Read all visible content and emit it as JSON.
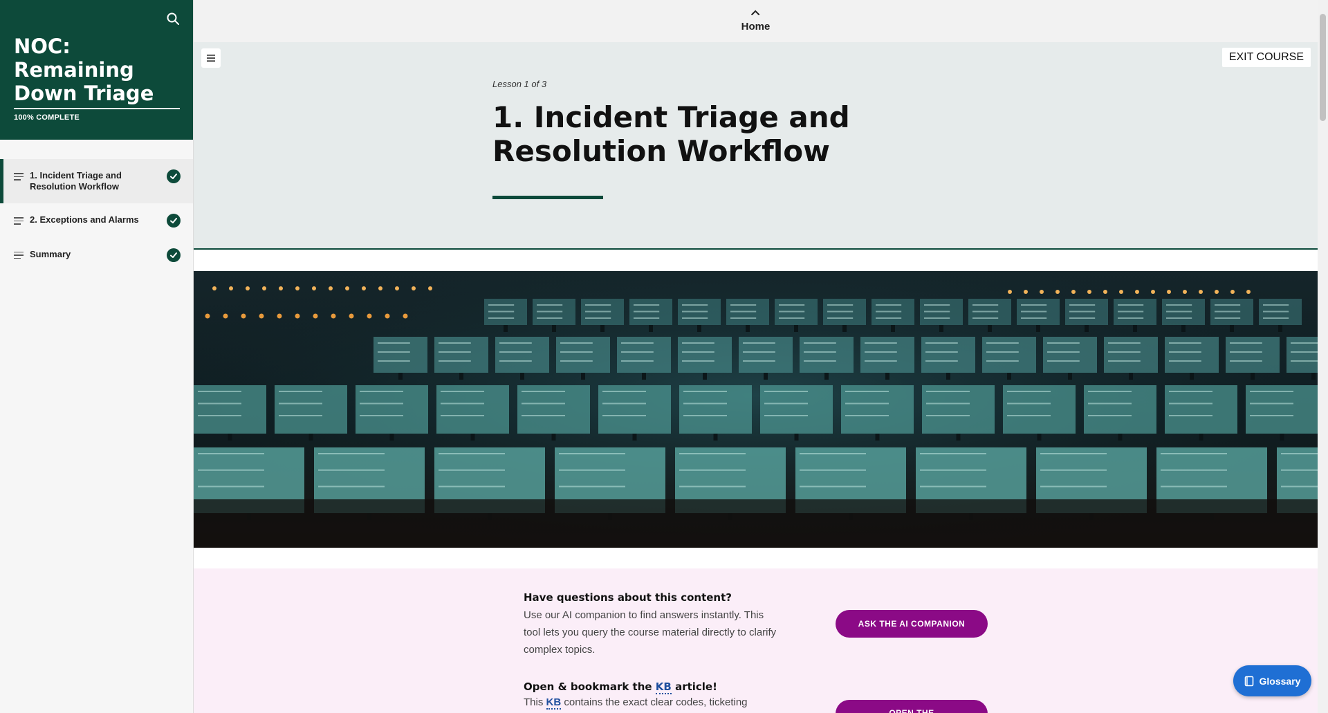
{
  "sidebar": {
    "course_title": "NOC: Remaining Down Triage",
    "progress_label": "100% COMPLETE",
    "progress_percent": 100,
    "lessons": [
      {
        "label": "1. Incident Triage and Resolution Workflow",
        "complete": true,
        "active": true
      },
      {
        "label": "2. Exceptions and Alarms",
        "complete": true,
        "active": false
      },
      {
        "label": "Summary",
        "complete": true,
        "active": false
      }
    ]
  },
  "topbar": {
    "home_label": "Home"
  },
  "hero": {
    "exit_label": "EXIT COURSE",
    "lesson_counter": "Lesson 1 of 3",
    "lesson_title": "1. Incident Triage and Resolution Workflow"
  },
  "ai_section": {
    "question_title": "Have questions about this content?",
    "question_body": "Use our AI companion to find answers instantly. This tool lets you query the course material directly to clarify complex topics.",
    "ai_button_label": "ASK THE AI COMPANION",
    "kb_title_prefix": "Open & bookmark the ",
    "kb_abbr": "KB",
    "kb_title_suffix": " article!",
    "kb_body_prefix": "This ",
    "kb_body_suffix": " contains the exact clear codes, ticketing",
    "kb_button_label": "OPEN THE"
  },
  "glossary": {
    "label": "Glossary"
  },
  "colors": {
    "brand": "#0d4a3a",
    "accent": "#8b0a86",
    "glossary": "#1f6fd4"
  },
  "icons": [
    "search-icon",
    "check-icon",
    "list-icon",
    "chevron-up-icon",
    "hamburger-icon",
    "book-icon"
  ]
}
